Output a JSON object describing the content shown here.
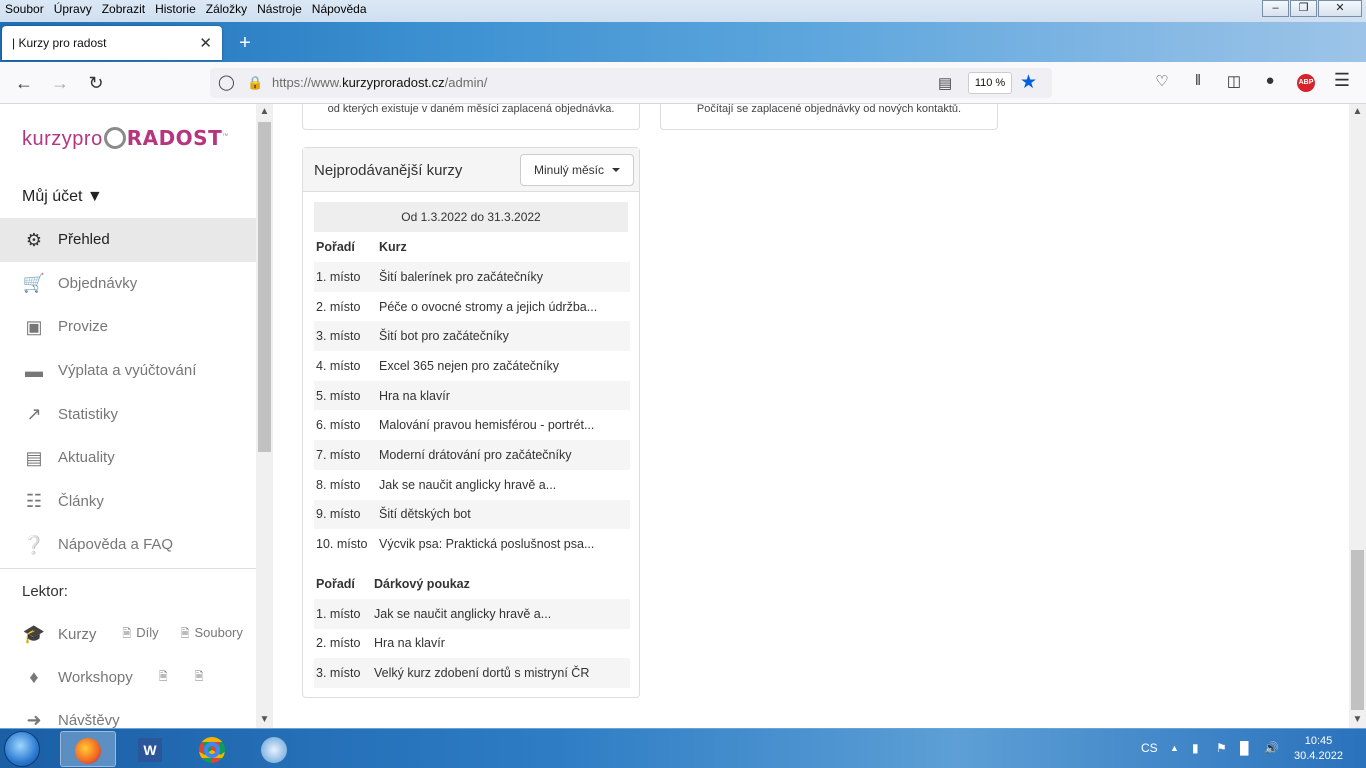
{
  "menu": {
    "items": [
      "Soubor",
      "Úpravy",
      "Zobrazit",
      "Historie",
      "Záložky",
      "Nástroje",
      "Nápověda"
    ]
  },
  "window_controls": {
    "minimize": "‒",
    "maximize": "❐",
    "close": "✕"
  },
  "tab": {
    "title": "| Kurzy pro radost",
    "close": "✕",
    "new_tab": "+"
  },
  "nav": {
    "back_icon": "arrow-left-icon",
    "forward_icon": "arrow-right-icon",
    "reload_icon": "reload-icon",
    "url_prefix": "https://www.",
    "url_domain": "kurzyproradost.cz",
    "url_path": "/admin/",
    "zoom": "110 %"
  },
  "logo": {
    "part1": "kurzypro",
    "part2": "RADOST",
    "tm": "™"
  },
  "sidebar": {
    "account": "Můj účet ▼",
    "items": [
      {
        "label": "Přehled",
        "icon": "dashboard-icon",
        "active": true
      },
      {
        "label": "Objednávky",
        "icon": "cart-icon"
      },
      {
        "label": "Provize",
        "icon": "money-icon"
      },
      {
        "label": "Výplata a vyúčtování",
        "icon": "credit-card-icon"
      },
      {
        "label": "Statistiky",
        "icon": "chart-icon"
      },
      {
        "label": "Aktuality",
        "icon": "inbox-icon"
      },
      {
        "label": "Články",
        "icon": "newspaper-icon"
      },
      {
        "label": "Nápověda a FAQ",
        "icon": "help-icon"
      }
    ],
    "lektor_label": "Lektor:",
    "kurzy": "Kurzy",
    "dily": "Díly",
    "soubory": "Soubory",
    "workshopy": "Workshopy",
    "navstevy": "Návštěvy"
  },
  "top_cards": {
    "left_text": "od kterých existuje v daném měsíci zaplacená objednávka.",
    "right_text": "Počítají se zaplacené objednávky od nových kontaktů."
  },
  "panel": {
    "title": "Nejprodávanější kurzy",
    "dropdown": "Minulý měsíc",
    "date_range": "Od 1.3.2022 do 31.3.2022",
    "courses_header": {
      "rank": "Pořadí",
      "name": "Kurz"
    },
    "courses": [
      {
        "rank": "1. místo",
        "name": "Šití balerínek pro začátečníky"
      },
      {
        "rank": "2. místo",
        "name": "Péče o ovocné stromy a jejich údržba..."
      },
      {
        "rank": "3. místo",
        "name": "Šití bot pro začátečníky"
      },
      {
        "rank": "4. místo",
        "name": "Excel 365 nejen pro začátečníky"
      },
      {
        "rank": "5. místo",
        "name": "Hra na klavír"
      },
      {
        "rank": "6. místo",
        "name": "Malování pravou hemisférou - portrét..."
      },
      {
        "rank": "7. místo",
        "name": "Moderní drátování pro začátečníky"
      },
      {
        "rank": "8. místo",
        "name": "Jak se naučit anglicky hravě a..."
      },
      {
        "rank": "9. místo",
        "name": "Šití dětských bot"
      },
      {
        "rank": "10. místo",
        "name": "Výcvik psa: Praktická poslušnost psa..."
      }
    ],
    "vouchers_header": {
      "rank": "Pořadí",
      "name": "Dárkový poukaz"
    },
    "vouchers": [
      {
        "rank": "1. místo",
        "name": "Jak se naučit anglicky hravě a..."
      },
      {
        "rank": "2. místo",
        "name": "Hra na klavír"
      },
      {
        "rank": "3. místo",
        "name": "Velký kurz zdobení dortů s mistryní ČR"
      }
    ]
  },
  "taskbar": {
    "lang": "CS",
    "time": "10:45",
    "date": "30.4.2022"
  }
}
